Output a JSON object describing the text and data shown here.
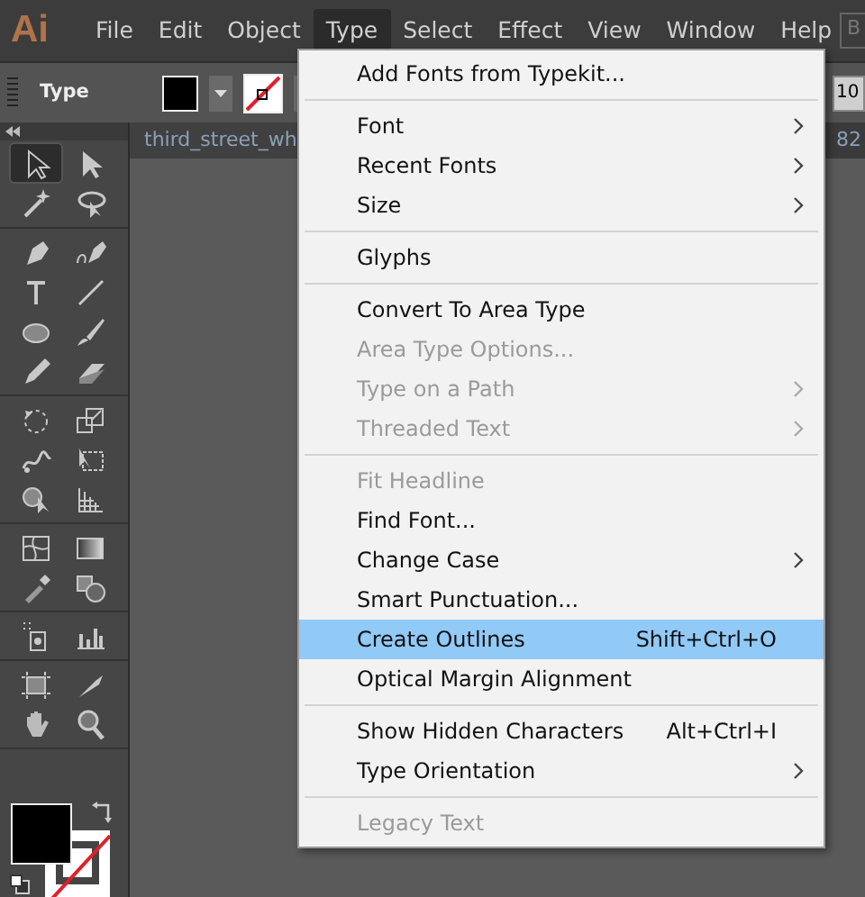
{
  "menubar": {
    "items": [
      {
        "label": "File",
        "selected": false
      },
      {
        "label": "Edit",
        "selected": false
      },
      {
        "label": "Object",
        "selected": false
      },
      {
        "label": "Type",
        "selected": true
      },
      {
        "label": "Select",
        "selected": false
      },
      {
        "label": "Effect",
        "selected": false
      },
      {
        "label": "View",
        "selected": false
      },
      {
        "label": "Window",
        "selected": false
      },
      {
        "label": "Help",
        "selected": false
      }
    ],
    "logo": "Ai",
    "bridge": "B"
  },
  "control_bar": {
    "label": "Type",
    "field": "10"
  },
  "document_tab": {
    "title": "third_street_wh",
    "zoom": "82"
  },
  "toolbox": {
    "groups": [
      [
        {
          "selected": true
        },
        {
          "selected": false
        },
        {
          "selected": false
        },
        {
          "selected": false
        }
      ],
      [
        {
          "selected": false
        },
        {
          "selected": false
        },
        {
          "selected": false
        },
        {
          "selected": false
        },
        {
          "selected": false
        },
        {
          "selected": false
        },
        {
          "selected": false
        },
        {
          "selected": false
        }
      ],
      [
        {
          "selected": false
        },
        {
          "selected": false
        },
        {
          "selected": false
        },
        {
          "selected": false
        },
        {
          "selected": false
        },
        {
          "selected": false
        }
      ],
      [
        {
          "selected": false
        },
        {
          "selected": false
        },
        {
          "selected": false
        },
        {
          "selected": false
        }
      ],
      [
        {
          "selected": false
        },
        {
          "selected": false
        }
      ],
      [
        {
          "selected": false
        },
        {
          "selected": false
        },
        {
          "selected": false
        },
        {
          "selected": false
        }
      ]
    ]
  },
  "menu": {
    "sections": [
      [
        {
          "label": "Add Fonts from Typekit...",
          "disabled": false,
          "submenu": false,
          "selected": false
        }
      ],
      [
        {
          "label": "Font",
          "disabled": false,
          "submenu": true,
          "selected": false
        },
        {
          "label": "Recent Fonts",
          "disabled": false,
          "submenu": true,
          "selected": false
        },
        {
          "label": "Size",
          "disabled": false,
          "submenu": true,
          "selected": false
        }
      ],
      [
        {
          "label": "Glyphs",
          "disabled": false,
          "submenu": false,
          "selected": false
        }
      ],
      [
        {
          "label": "Convert To Area Type",
          "disabled": false,
          "submenu": false,
          "selected": false
        },
        {
          "label": "Area Type Options...",
          "disabled": true,
          "submenu": false,
          "selected": false
        },
        {
          "label": "Type on a Path",
          "disabled": true,
          "submenu": true,
          "selected": false
        },
        {
          "label": "Threaded Text",
          "disabled": true,
          "submenu": true,
          "selected": false
        }
      ],
      [
        {
          "label": "Fit Headline",
          "disabled": true,
          "submenu": false,
          "selected": false
        },
        {
          "label": "Find Font...",
          "disabled": false,
          "submenu": false,
          "selected": false
        },
        {
          "label": "Change Case",
          "disabled": false,
          "submenu": true,
          "selected": false
        },
        {
          "label": "Smart Punctuation...",
          "disabled": false,
          "submenu": false,
          "selected": false
        },
        {
          "label": "Create Outlines",
          "shortcut": "Shift+Ctrl+O",
          "disabled": false,
          "submenu": false,
          "selected": true
        },
        {
          "label": "Optical Margin Alignment",
          "disabled": false,
          "submenu": false,
          "selected": false
        }
      ],
      [
        {
          "label": "Show Hidden Characters",
          "shortcut": "Alt+Ctrl+I",
          "disabled": false,
          "submenu": false,
          "selected": false
        },
        {
          "label": "Type Orientation",
          "disabled": false,
          "submenu": true,
          "selected": false
        }
      ],
      [
        {
          "label": "Legacy Text",
          "disabled": true,
          "submenu": false,
          "selected": false
        }
      ]
    ]
  }
}
